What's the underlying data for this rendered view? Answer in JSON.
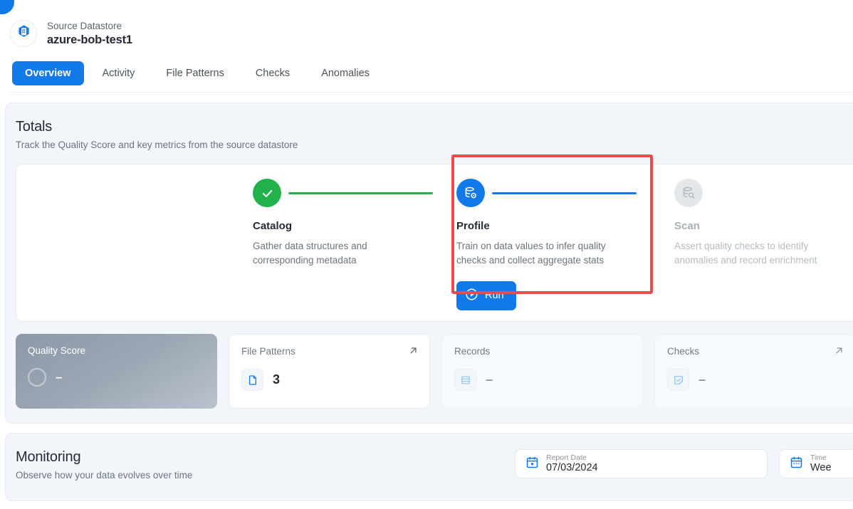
{
  "header": {
    "kicker": "Source Datastore",
    "name": "azure-bob-test1",
    "avatar_icon": "azure-blob-storage-icon"
  },
  "tabs": [
    {
      "label": "Overview",
      "active": true
    },
    {
      "label": "Activity",
      "active": false
    },
    {
      "label": "File Patterns",
      "active": false
    },
    {
      "label": "Checks",
      "active": false
    },
    {
      "label": "Anomalies",
      "active": false
    }
  ],
  "totals": {
    "title": "Totals",
    "subtitle": "Track the Quality Score and key metrics from the source datastore",
    "stages": [
      {
        "key": "catalog",
        "name": "Catalog",
        "description": "Gather data structures and corresponding metadata",
        "icon": "check-icon",
        "state": "complete",
        "connector_color": "#22b24c"
      },
      {
        "key": "profile",
        "name": "Profile",
        "description": "Train on data values to infer quality checks and collect aggregate stats",
        "icon": "database-profile-icon",
        "state": "active",
        "connector_color": "#1279e8",
        "action_label": "Run",
        "action_icon": "play-circle-icon",
        "highlighted": true
      },
      {
        "key": "scan",
        "name": "Scan",
        "description": "Assert quality checks to identify anomalies and record enrichment",
        "icon": "database-search-icon",
        "state": "disabled"
      }
    ],
    "metrics": [
      {
        "key": "quality-score",
        "label": "Quality Score",
        "value": "–",
        "style": "score",
        "icon": "score-ring-icon",
        "has_link": false
      },
      {
        "key": "file-patterns",
        "label": "File Patterns",
        "value": "3",
        "style": "normal",
        "icon": "file-icon",
        "has_link": true
      },
      {
        "key": "records",
        "label": "Records",
        "value": "–",
        "style": "faded",
        "icon": "records-icon",
        "has_link": false
      },
      {
        "key": "checks",
        "label": "Checks",
        "value": "–",
        "style": "faded",
        "icon": "checks-icon",
        "has_link": true
      }
    ]
  },
  "monitoring": {
    "title": "Monitoring",
    "subtitle": "Observe how your data evolves over time",
    "report_date": {
      "label": "Report Date",
      "value": "07/03/2024",
      "icon": "calendar-icon"
    },
    "time_frame": {
      "label": "Time",
      "value": "Wee",
      "icon": "calendar-range-icon"
    }
  },
  "colors": {
    "accent": "#1279e8",
    "success": "#22b24c",
    "highlight": "#ec4b4b",
    "panel_bg": "#f2f6fa"
  }
}
